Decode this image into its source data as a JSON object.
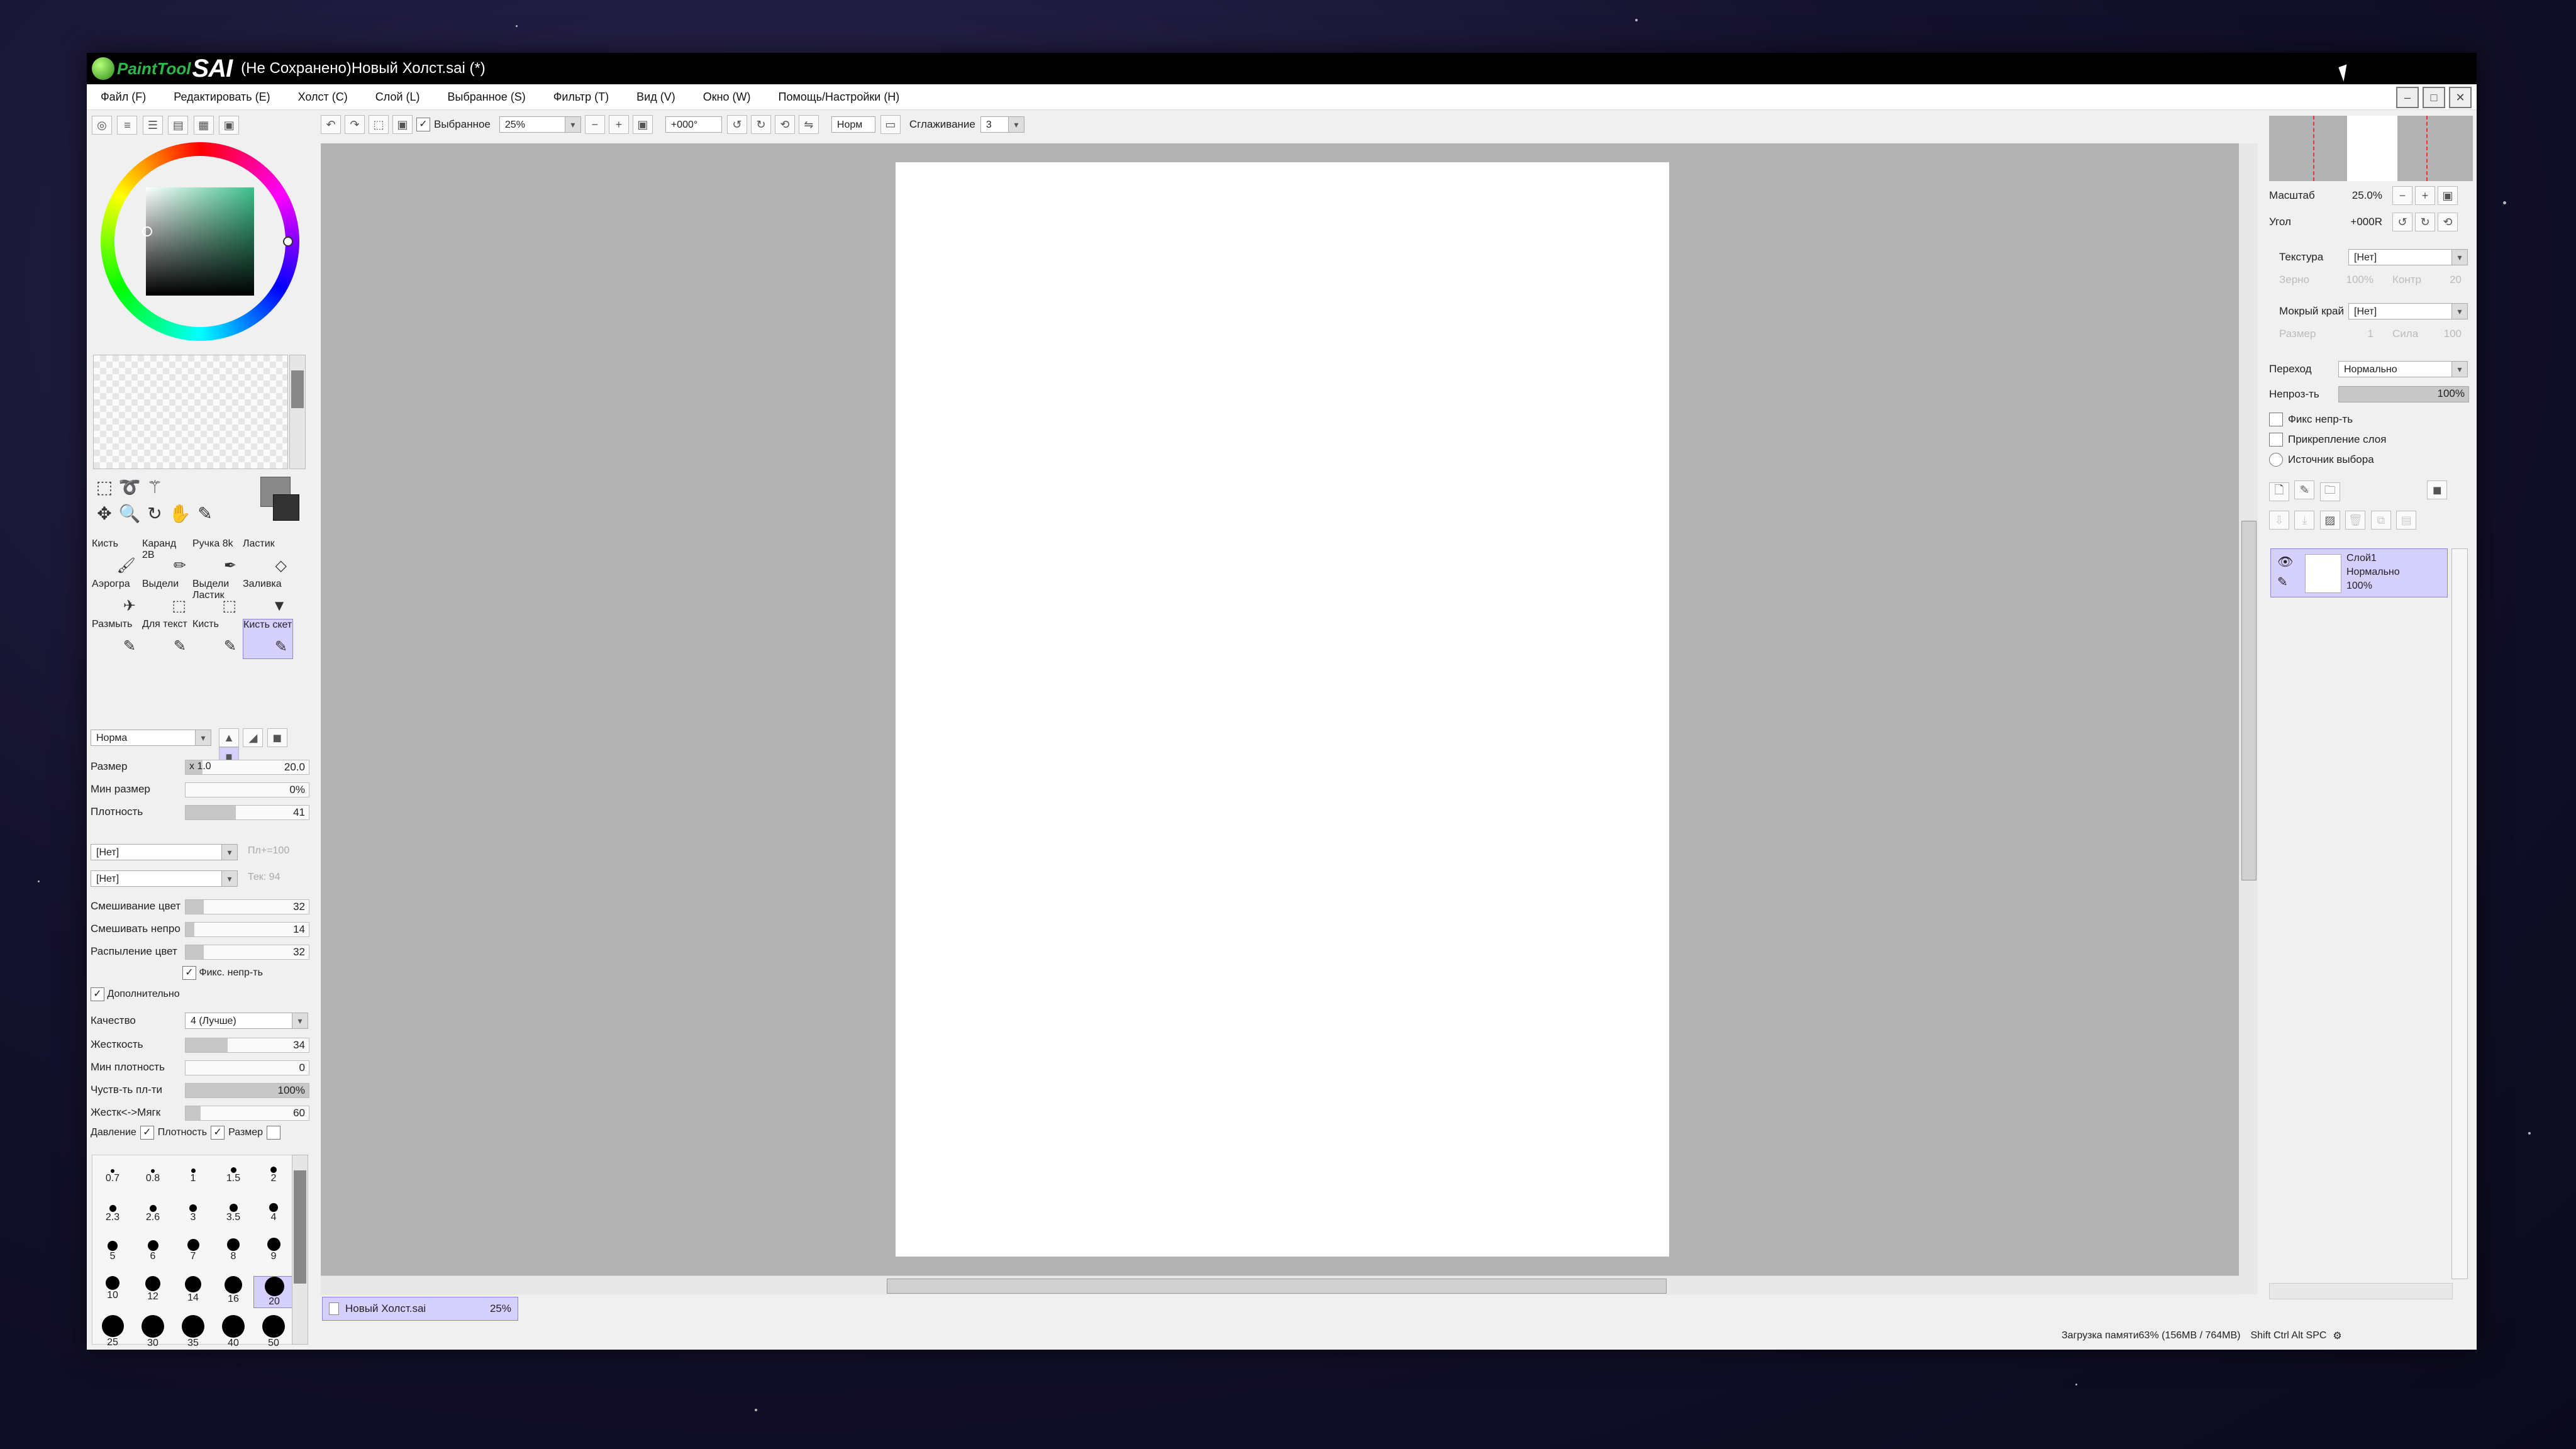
{
  "app": {
    "logo_text": "PaintTool",
    "logo_sai": "SAI",
    "window_title": "(Не Сохранено)Новый Холст.sai (*)"
  },
  "menu": [
    "Файл (F)",
    "Редактировать (E)",
    "Холст (C)",
    "Слой (L)",
    "Выбранное (S)",
    "Фильтр (T)",
    "Вид (V)",
    "Окно (W)",
    "Помощь/Настройки (H)"
  ],
  "toolbar": {
    "selection_label": "Выбранное",
    "zoom": "25%",
    "angle": "+000°",
    "mode": "Норм",
    "smoothing_label": "Сглаживание",
    "smoothing_value": "3"
  },
  "tools": {
    "brushes": [
      {
        "name": "Кисть",
        "icon": "brush-icon"
      },
      {
        "name": "Каранд 2B",
        "icon": "pencil-icon"
      },
      {
        "name": "Ручка 8k",
        "icon": "pen-icon"
      },
      {
        "name": "Ластик",
        "icon": "eraser-icon"
      },
      {
        "name": "Аэрогра",
        "icon": "airbrush-icon"
      },
      {
        "name": "Выдели",
        "icon": "select-pen-icon"
      },
      {
        "name": "Выдели Ластик",
        "icon": "select-eraser-icon"
      },
      {
        "name": "Заливка",
        "icon": "fill-icon"
      },
      {
        "name": "Размыть",
        "icon": "blur-icon"
      },
      {
        "name": "Для текст",
        "icon": "texture-brush-icon"
      },
      {
        "name": "Кисть",
        "icon": "brush-icon"
      },
      {
        "name": "Кисть скет",
        "icon": "sketch-brush-icon"
      }
    ]
  },
  "brush_props": {
    "mode": "Норма",
    "size_label": "Размер",
    "size_mult": "x 1.0",
    "size_value": "20.0",
    "min_size_label": "Мин размер",
    "min_size_value": "0%",
    "density_label": "Плотность",
    "density_value": "41",
    "texture1": "[Нет]",
    "texture1_aux": "Пл+=100",
    "texture2": "[Нет]",
    "texture2_aux": "Тек: 94",
    "mix_color_label": "Смешивание цвет",
    "mix_color_value": "32",
    "mix_opacity_label": "Смешивать непро",
    "mix_opacity_value": "14",
    "spread_label": "Распыление цвет",
    "spread_value": "32",
    "fix_opacity_label": "Фикс. непр-ть",
    "advanced_label": "Дополнительно",
    "quality_label": "Качество",
    "quality_value": "4 (Лучше)",
    "hardness_label": "Жесткость",
    "hardness_value": "34",
    "min_density_label": "Мин плотность",
    "min_density_value": "0",
    "sensitivity_label": "Чуств-ть пл-ти",
    "sensitivity_value": "100%",
    "hardsoft_label": "Жестк<->Мягк",
    "hardsoft_value": "60",
    "pressure_label": "Давление",
    "pressure_density_label": "Плотность",
    "pressure_size_label": "Размер"
  },
  "brush_sizes": [
    [
      "0.7",
      "0.8",
      "1",
      "1.5",
      "2"
    ],
    [
      "2.3",
      "2.6",
      "3",
      "3.5",
      "4"
    ],
    [
      "5",
      "6",
      "7",
      "8",
      "9"
    ],
    [
      "10",
      "12",
      "14",
      "16",
      "20"
    ],
    [
      "25",
      "30",
      "35",
      "40",
      "50"
    ]
  ],
  "navigator": {
    "zoom_label": "Масштаб",
    "zoom_value": "25.0%",
    "angle_label": "Угол",
    "angle_value": "+000R"
  },
  "layer_props": {
    "texture_label": "Текстура",
    "texture_value": "[Нет]",
    "texture_scale_label": "Зерно",
    "texture_scale_value": "100%",
    "texture_contrast_label": "Контр",
    "texture_contrast_value": "20",
    "wet_edge_label": "Мокрый край",
    "wet_edge_value": "[Нет]",
    "wet_size_label": "Размер",
    "wet_size_value": "1",
    "wet_strength_label": "Сила",
    "wet_strength_value": "100",
    "blend_label": "Переход",
    "blend_value": "Нормально",
    "opacity_label": "Непроз-ть",
    "opacity_value": "100%",
    "fix_opacity_label": "Фикс непр-ть",
    "clip_layer_label": "Прикрепление слоя",
    "selection_source_label": "Источник выбора"
  },
  "layer": {
    "name": "Слой1",
    "mode": "Нормально",
    "opacity": "100%"
  },
  "doc_tab": {
    "name": "Новый Холст.sai",
    "zoom": "25%"
  },
  "status": {
    "memory": "Загрузка памяти63% (156MB / 764MB)",
    "keys": "Shift Ctrl Alt SPC"
  }
}
